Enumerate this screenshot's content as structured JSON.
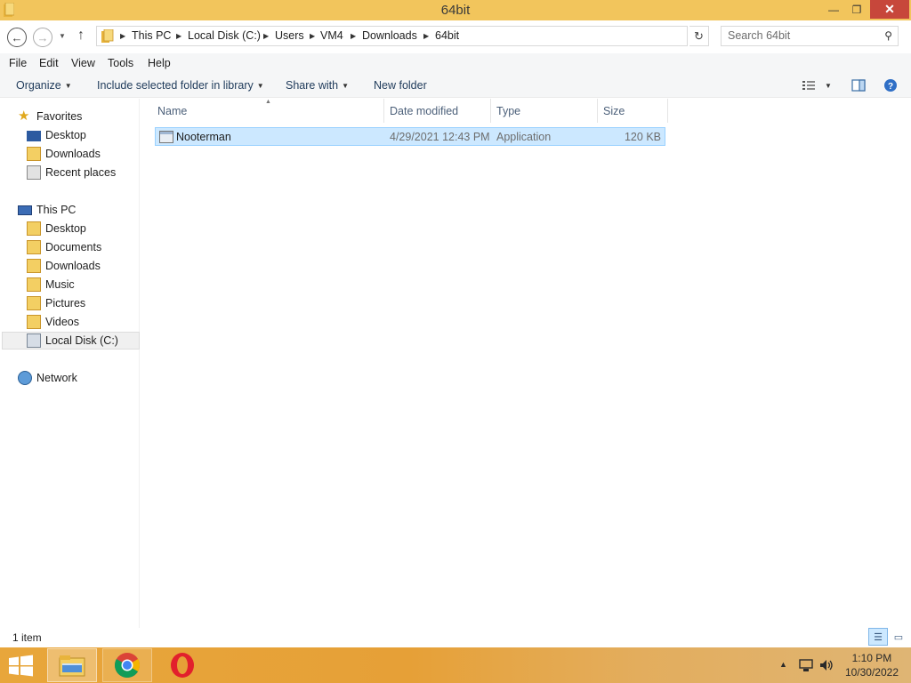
{
  "window": {
    "title": "64bit",
    "controls": {
      "minimize": "—",
      "maximize": "❐",
      "close": "✕"
    }
  },
  "address": {
    "breadcrumbs": [
      "This PC",
      "Local Disk (C:)",
      "Users",
      "VM4",
      "Downloads",
      "64bit"
    ],
    "search_placeholder": "Search 64bit"
  },
  "menu": {
    "items": [
      "File",
      "Edit",
      "View",
      "Tools",
      "Help"
    ]
  },
  "commands": {
    "organize": "Organize",
    "include_library": "Include selected folder in library",
    "share_with": "Share with",
    "new_folder": "New folder"
  },
  "nav": {
    "favorites": {
      "label": "Favorites",
      "items": [
        "Desktop",
        "Downloads",
        "Recent places"
      ]
    },
    "this_pc": {
      "label": "This PC",
      "items": [
        "Desktop",
        "Documents",
        "Downloads",
        "Music",
        "Pictures",
        "Videos",
        "Local Disk (C:)"
      ]
    },
    "network": {
      "label": "Network"
    }
  },
  "columns": {
    "name": "Name",
    "date": "Date modified",
    "type": "Type",
    "size": "Size"
  },
  "files": [
    {
      "name": "Nooterman",
      "date": "4/29/2021 12:43 PM",
      "type": "Application",
      "size": "120 KB"
    }
  ],
  "status": {
    "item_count": "1 item"
  },
  "taskbar": {
    "apps": [
      "File Explorer",
      "Google Chrome",
      "Opera"
    ],
    "time": "1:10 PM",
    "date": "10/30/2022"
  },
  "colors": {
    "title_bar": "#f2c55c",
    "close_button": "#c7473b",
    "selection": "#cce8ff",
    "taskbar": "#e8a63b"
  }
}
